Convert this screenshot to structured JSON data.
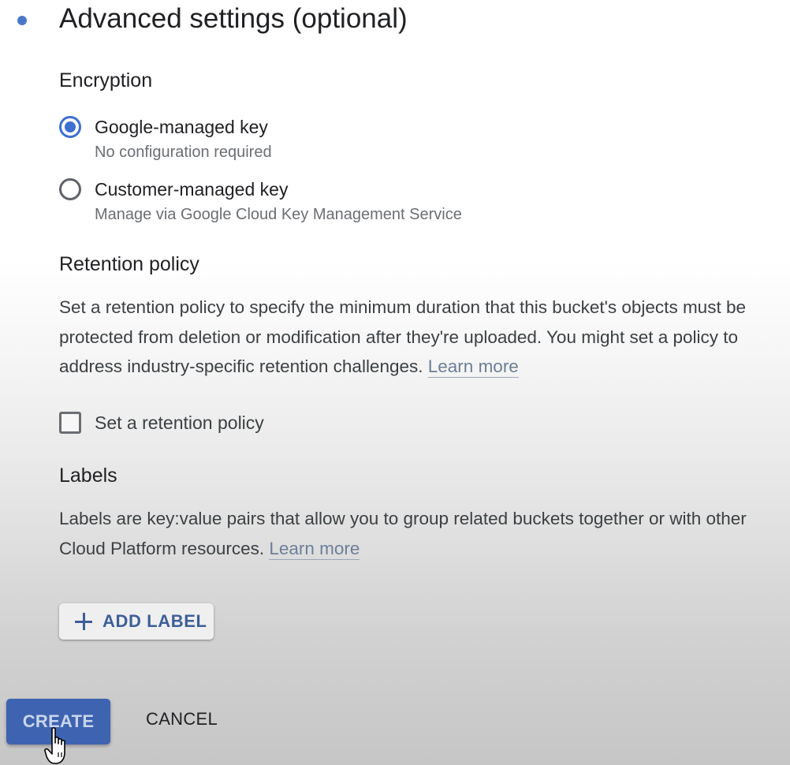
{
  "section": {
    "title": "Advanced settings (optional)"
  },
  "encryption": {
    "heading": "Encryption",
    "options": [
      {
        "label": "Google-managed key",
        "description": "No configuration required",
        "selected": true
      },
      {
        "label": "Customer-managed key",
        "description": "Manage via Google Cloud Key Management Service",
        "selected": false
      }
    ]
  },
  "retention": {
    "heading": "Retention policy",
    "description": "Set a retention policy to specify the minimum duration that this bucket's objects must be protected from deletion or modification after they're uploaded. You might set a policy to address industry-specific retention challenges.",
    "learn_more": "Learn more",
    "checkbox_label": "Set a retention policy",
    "checked": false
  },
  "labels": {
    "heading": "Labels",
    "description": "Labels are key:value pairs that allow you to group related buckets together or with other Cloud Platform resources.",
    "learn_more": "Learn more",
    "add_button": "ADD LABEL"
  },
  "actions": {
    "create": "CREATE",
    "cancel": "CANCEL"
  },
  "icons": {
    "bullet": "bullet-dot-icon",
    "add": "plus-icon",
    "cursor": "hand-pointer-cursor-icon"
  },
  "colors": {
    "accent": "#3c6fd1",
    "primary_button": "#3e63b0",
    "link": "#6b7f99"
  }
}
